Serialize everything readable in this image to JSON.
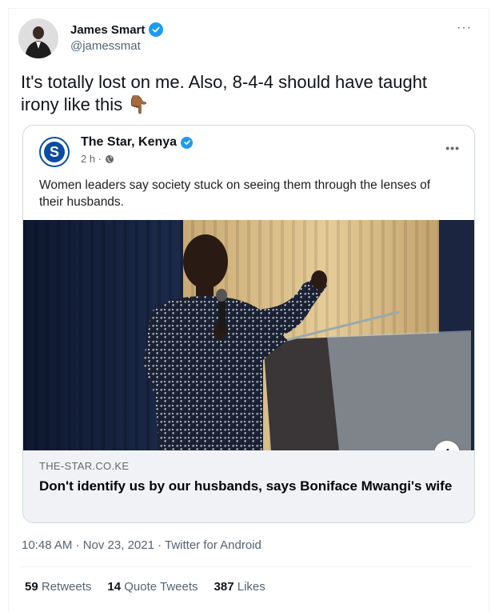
{
  "tweet": {
    "author_name": "James Smart",
    "author_handle": "@jamessmat",
    "more_label": "···",
    "text": "It's totally lost on me. Also, 8-4-4 should have taught irony like this",
    "emoji": "👇🏾"
  },
  "card": {
    "page_name": "The Star, Kenya",
    "logo_letter": "S",
    "time": "2 h ·",
    "more_label": "•••",
    "post_text": "Women leaders say society stuck on seeing them through the lenses of their husbands.",
    "info_label": "i",
    "link_domain": "THE-STAR.CO.KE",
    "link_headline": "Don't identify us by our husbands, says Boniface Mwangi's wife"
  },
  "meta": {
    "text": "10:48 AM · Nov 23, 2021 · Twitter for Android"
  },
  "stats": {
    "retweets_count": "59",
    "retweets_label": "Retweets",
    "quotes_count": "14",
    "quotes_label": "Quote Tweets",
    "likes_count": "387",
    "likes_label": "Likes"
  },
  "colors": {
    "verified": "#1d9bf0",
    "star_brand": "#0b4da2",
    "secondary_text": "#536471"
  }
}
